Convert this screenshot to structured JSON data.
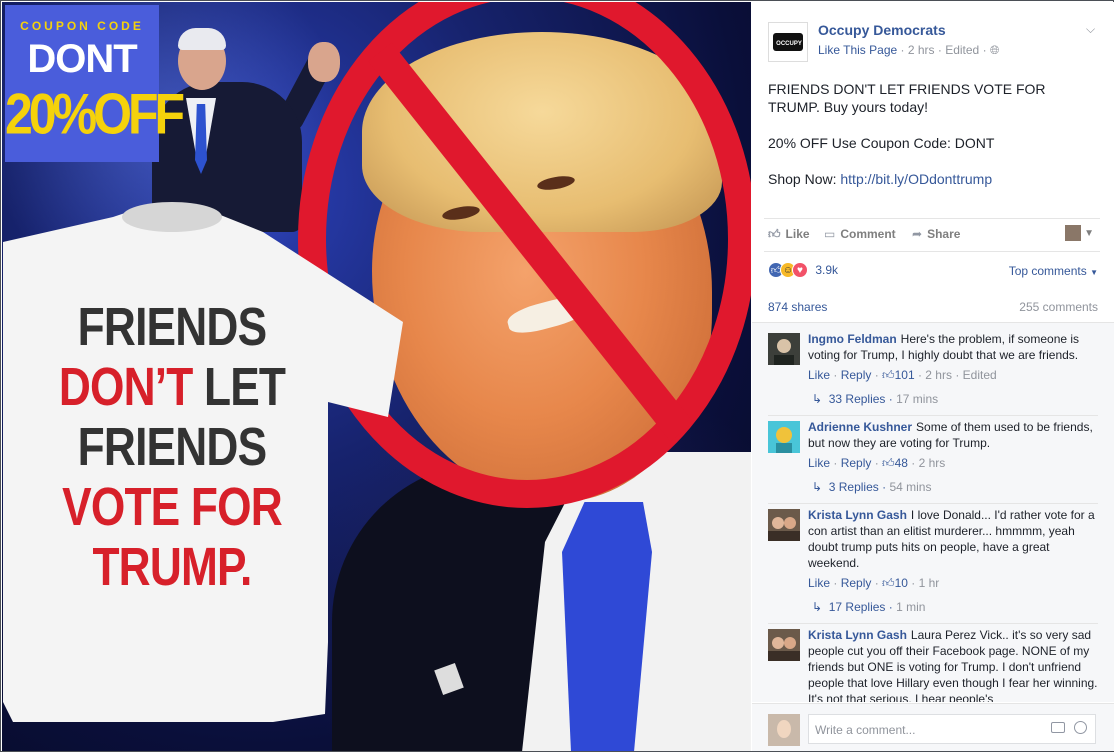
{
  "image": {
    "coupon_label": "COUPON CODE",
    "coupon_code": "DONT",
    "coupon_discount": "20%OFF",
    "shirt_lines": [
      {
        "text": "FRIENDS",
        "color": "#333333"
      },
      {
        "text": "DON'T LET",
        "color": "mixed"
      },
      {
        "text": "FRIENDS",
        "color": "#333333"
      },
      {
        "text": "VOTE FOR",
        "color": "#d7202a"
      },
      {
        "text": "TRUMP.",
        "color": "#d7202a"
      }
    ],
    "shirt_line2_red": "DON’T",
    "shirt_line2_dark": "LET",
    "ban_color": "#e0182d"
  },
  "post": {
    "page_name": "Occupy Democrats",
    "avatar_text": "OCCUPY",
    "like_page": "Like This Page",
    "time": "2 hrs",
    "edited": "Edited",
    "paragraphs": [
      "FRIENDS DON'T LET FRIENDS VOTE FOR TRUMP. Buy yours today!",
      "20% OFF Use Coupon Code: DONT"
    ],
    "shop_prefix": "Shop Now: ",
    "shop_link": "http://bit.ly/ODdonttrump"
  },
  "actions": {
    "like": "Like",
    "comment": "Comment",
    "share": "Share"
  },
  "reactions": {
    "count": "3.9k",
    "top_comments": "Top comments"
  },
  "stats": {
    "shares": "874 shares",
    "comments": "255 comments"
  },
  "comments": [
    {
      "name": "Ingmo Feldman",
      "text": "Here's the problem, if someone is voting for Trump, I highly doubt that we are friends.",
      "like": "Like",
      "reply": "Reply",
      "likes": "101",
      "time": "2 hrs",
      "edited": "Edited",
      "replies": "33 Replies",
      "replies_time": "17 mins"
    },
    {
      "name": "Adrienne Kushner",
      "text": "Some of them used to be friends, but now they are voting for Trump.",
      "like": "Like",
      "reply": "Reply",
      "likes": "48",
      "time": "2 hrs",
      "replies": "3 Replies",
      "replies_time": "54 mins"
    },
    {
      "name": "Krista Lynn Gash",
      "text": "I love Donald... I'd rather vote for a con artist than an elitist murderer... hmmmm, yeah doubt trump puts hits on people, have a great weekend.",
      "like": "Like",
      "reply": "Reply",
      "likes": "10",
      "time": "1 hr",
      "replies": "17 Replies",
      "replies_time": "1 min"
    },
    {
      "name": "Krista Lynn Gash",
      "text": "Laura Perez Vick.. it's so very sad people cut you off their Facebook page. NONE of my friends but ONE is voting for Trump. I don't unfriend people that love Hillary even though I fear her winning. It's not that serious. I hear people's"
    }
  ],
  "composer": {
    "placeholder": "Write a comment..."
  },
  "colors": {
    "link": "#365899",
    "muted": "#90949c",
    "coupon_bg": "#4a5ddb",
    "coupon_yellow": "#f5d20b"
  }
}
